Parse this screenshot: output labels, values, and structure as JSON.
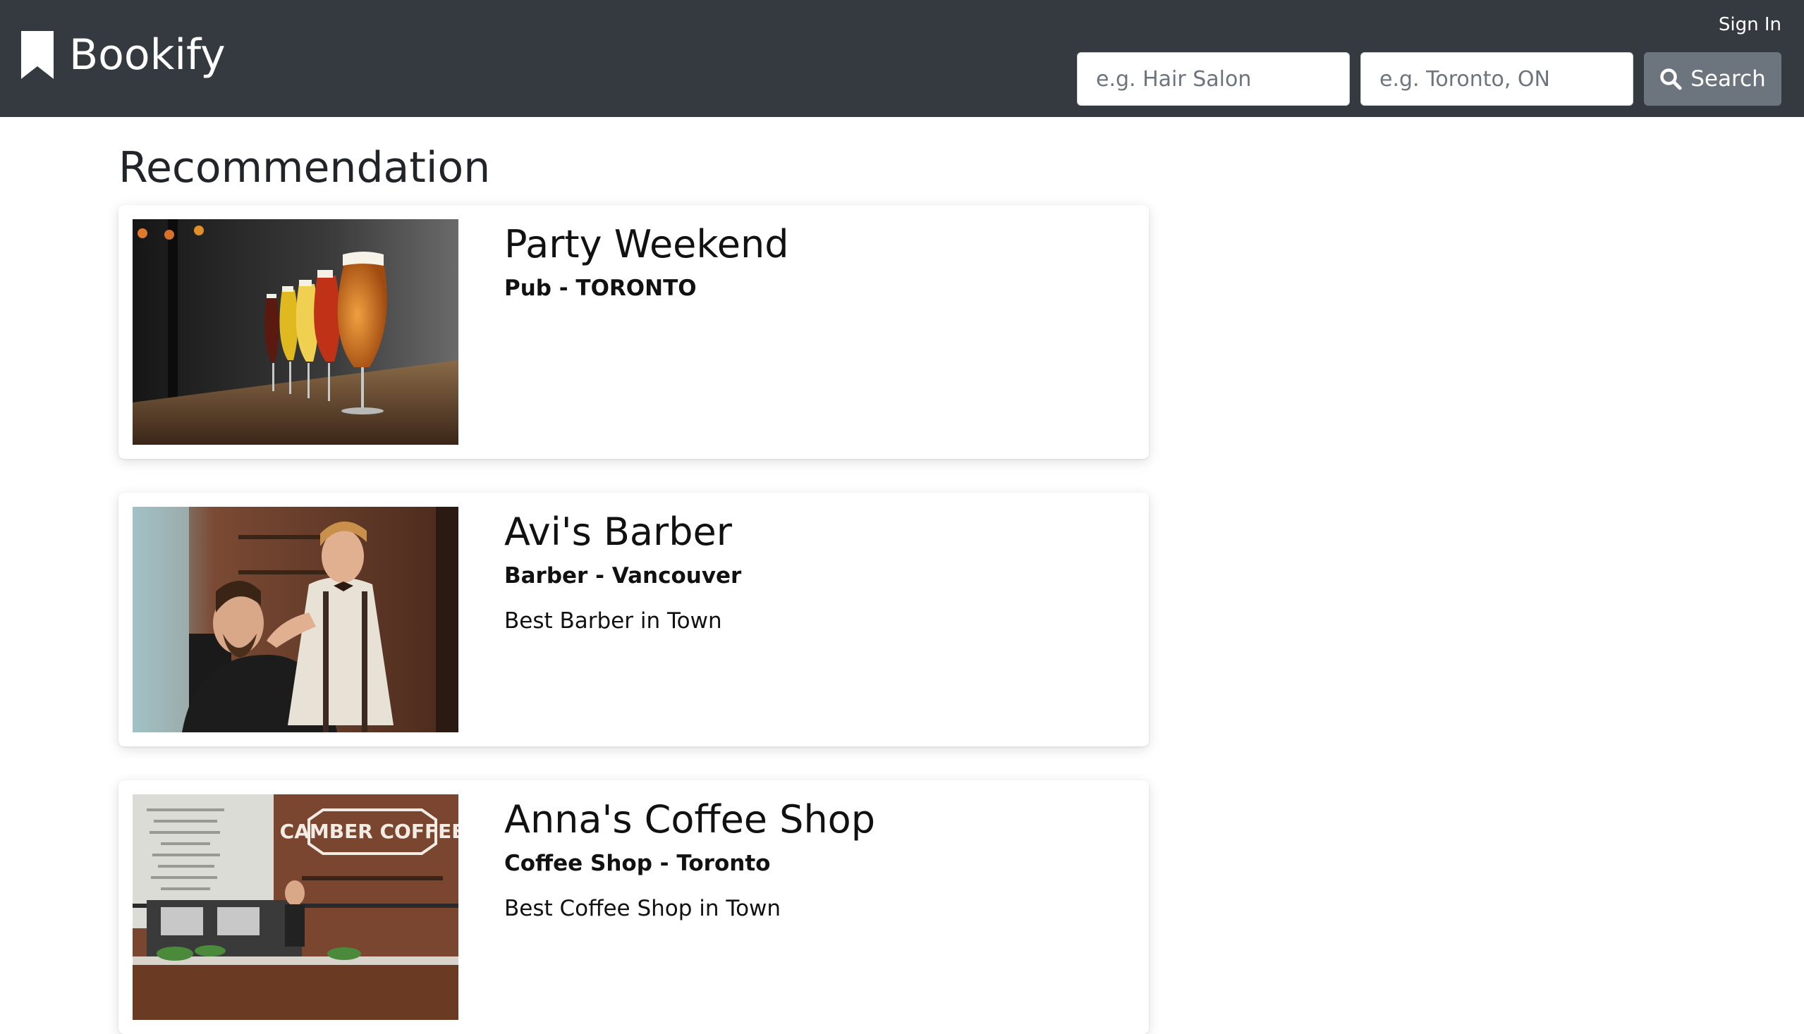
{
  "header": {
    "brand": "Bookify",
    "sign_in": "Sign In",
    "search": {
      "what_placeholder": "e.g. Hair Salon",
      "where_placeholder": "e.g. Toronto, ON",
      "button_label": "Search"
    }
  },
  "main": {
    "title": "Recommendation",
    "cards": [
      {
        "name": "Party Weekend",
        "subtitle": "Pub - TORONTO",
        "description": "",
        "image": "beer-glasses-photo"
      },
      {
        "name": "Avi's Barber",
        "subtitle": "Barber - Vancouver",
        "description": "Best Barber in Town",
        "image": "barber-shop-photo"
      },
      {
        "name": "Anna's Coffee Shop",
        "subtitle": "Coffee Shop - Toronto",
        "description": "Best Coffee Shop in Town",
        "image": "coffee-shop-photo",
        "image_sign_text": "CAMBER COFFEE"
      }
    ]
  },
  "colors": {
    "navbar": "#343a40",
    "search_button": "#6c757d",
    "page_background": "#ffffff"
  },
  "icons": [
    "bookmark-icon",
    "search-icon"
  ]
}
